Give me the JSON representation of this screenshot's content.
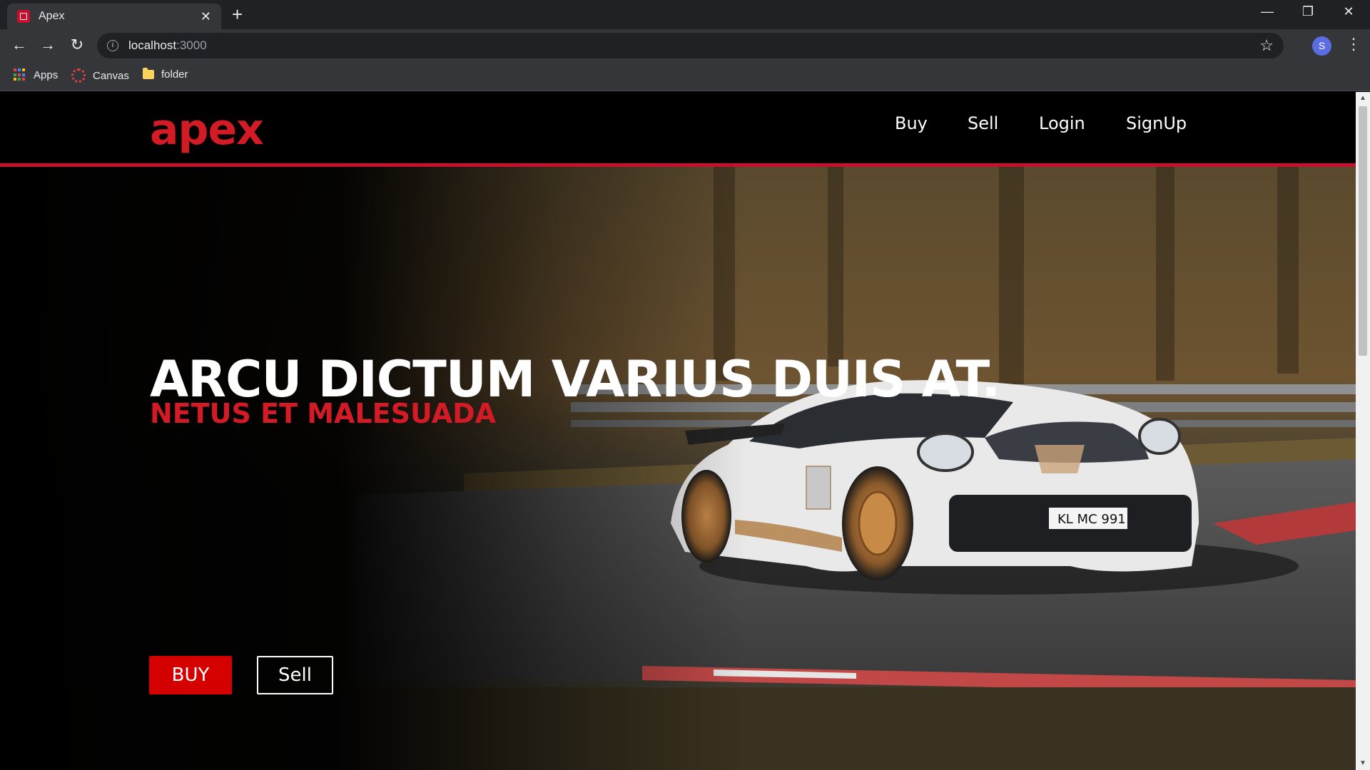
{
  "browser": {
    "tab": {
      "title": "Apex",
      "close": "✕"
    },
    "new_tab": "+",
    "window_controls": {
      "minimize": "—",
      "restore": "❐",
      "close": "✕"
    },
    "nav": {
      "back": "←",
      "forward": "→",
      "reload": "↻"
    },
    "address": {
      "host": "localhost",
      "port": ":3000"
    },
    "bookmark_star": "☆",
    "profile_initial": "S",
    "menu": "⋮",
    "bookmarks": [
      {
        "label": "Apps",
        "icon": "apps-grid-icon"
      },
      {
        "label": "Canvas",
        "icon": "canvas-icon"
      },
      {
        "label": "folder",
        "icon": "folder-icon"
      }
    ]
  },
  "site": {
    "logo": "apex",
    "nav": [
      "Buy",
      "Sell",
      "Login",
      "SignUp"
    ],
    "hero": {
      "title": "ARCU DICTUM VARIUS DUIS AT.",
      "subtitle": "NETUS ET MALESUADA",
      "buttons": {
        "buy": "BUY",
        "sell": "Sell"
      },
      "image": "race-car-photo"
    }
  },
  "colors": {
    "brand_red": "#d31b26",
    "buy_button": "#d50000",
    "header_bg": "#000000",
    "chrome_dark": "#202124",
    "chrome_mid": "#35363a"
  }
}
